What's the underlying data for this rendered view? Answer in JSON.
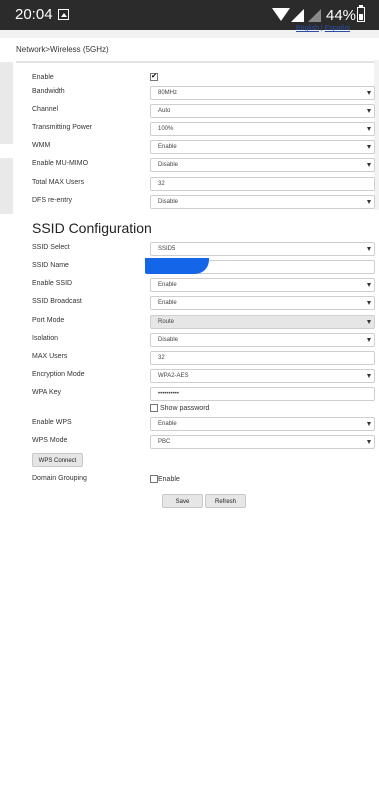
{
  "status_bar": {
    "time": "20:04",
    "battery": "44%"
  },
  "header": {
    "lang_english": "English",
    "lang_separator": " | ",
    "lang_espanol": "Español",
    "breadcrumb": "Network>Wireless (5GHz)"
  },
  "wireless": {
    "enable_label": "Enable",
    "bandwidth_label": "Bandwidth",
    "bandwidth_value": "80MHz",
    "channel_label": "Channel",
    "channel_value": "Auto",
    "power_label": "Transmitting Power",
    "power_value": "100%",
    "wmm_label": "WMM",
    "wmm_value": "Enable",
    "mumimo_label": "Enable MU-MIMO",
    "mumimo_value": "Disable",
    "maxusers_label": "Total MAX Users",
    "maxusers_value": "32",
    "dfs_label": "DFS re-entry",
    "dfs_value": "Disable"
  },
  "ssid": {
    "section_title": "SSID Configuration",
    "select_label": "SSID Select",
    "select_value": "SSID5",
    "name_label": "SSID Name",
    "enable_label": "Enable SSID",
    "enable_value": "Enable",
    "broadcast_label": "SSID Broadcast",
    "broadcast_value": "Enable",
    "portmode_label": "Port Mode",
    "portmode_value": "Route",
    "isolation_label": "Isolation",
    "isolation_value": "Disable",
    "maxusers_label": "MAX Users",
    "maxusers_value": "32",
    "encryption_label": "Encryption Mode",
    "encryption_value": "WPA2-AES",
    "wpakey_label": "WPA Key",
    "wpakey_value": "••••••••••",
    "show_password_label": "Show password",
    "wps_enable_label": "Enable WPS",
    "wps_enable_value": "Enable",
    "wps_mode_label": "WPS Mode",
    "wps_mode_value": "PBC",
    "wps_connect_label": "WPS Connect",
    "domain_grouping_label": "Domain Grouping",
    "domain_grouping_check_label": "Enable"
  },
  "actions": {
    "save_label": "Save",
    "refresh_label": "Refresh"
  },
  "icons": {
    "enable_checked": "✔"
  }
}
